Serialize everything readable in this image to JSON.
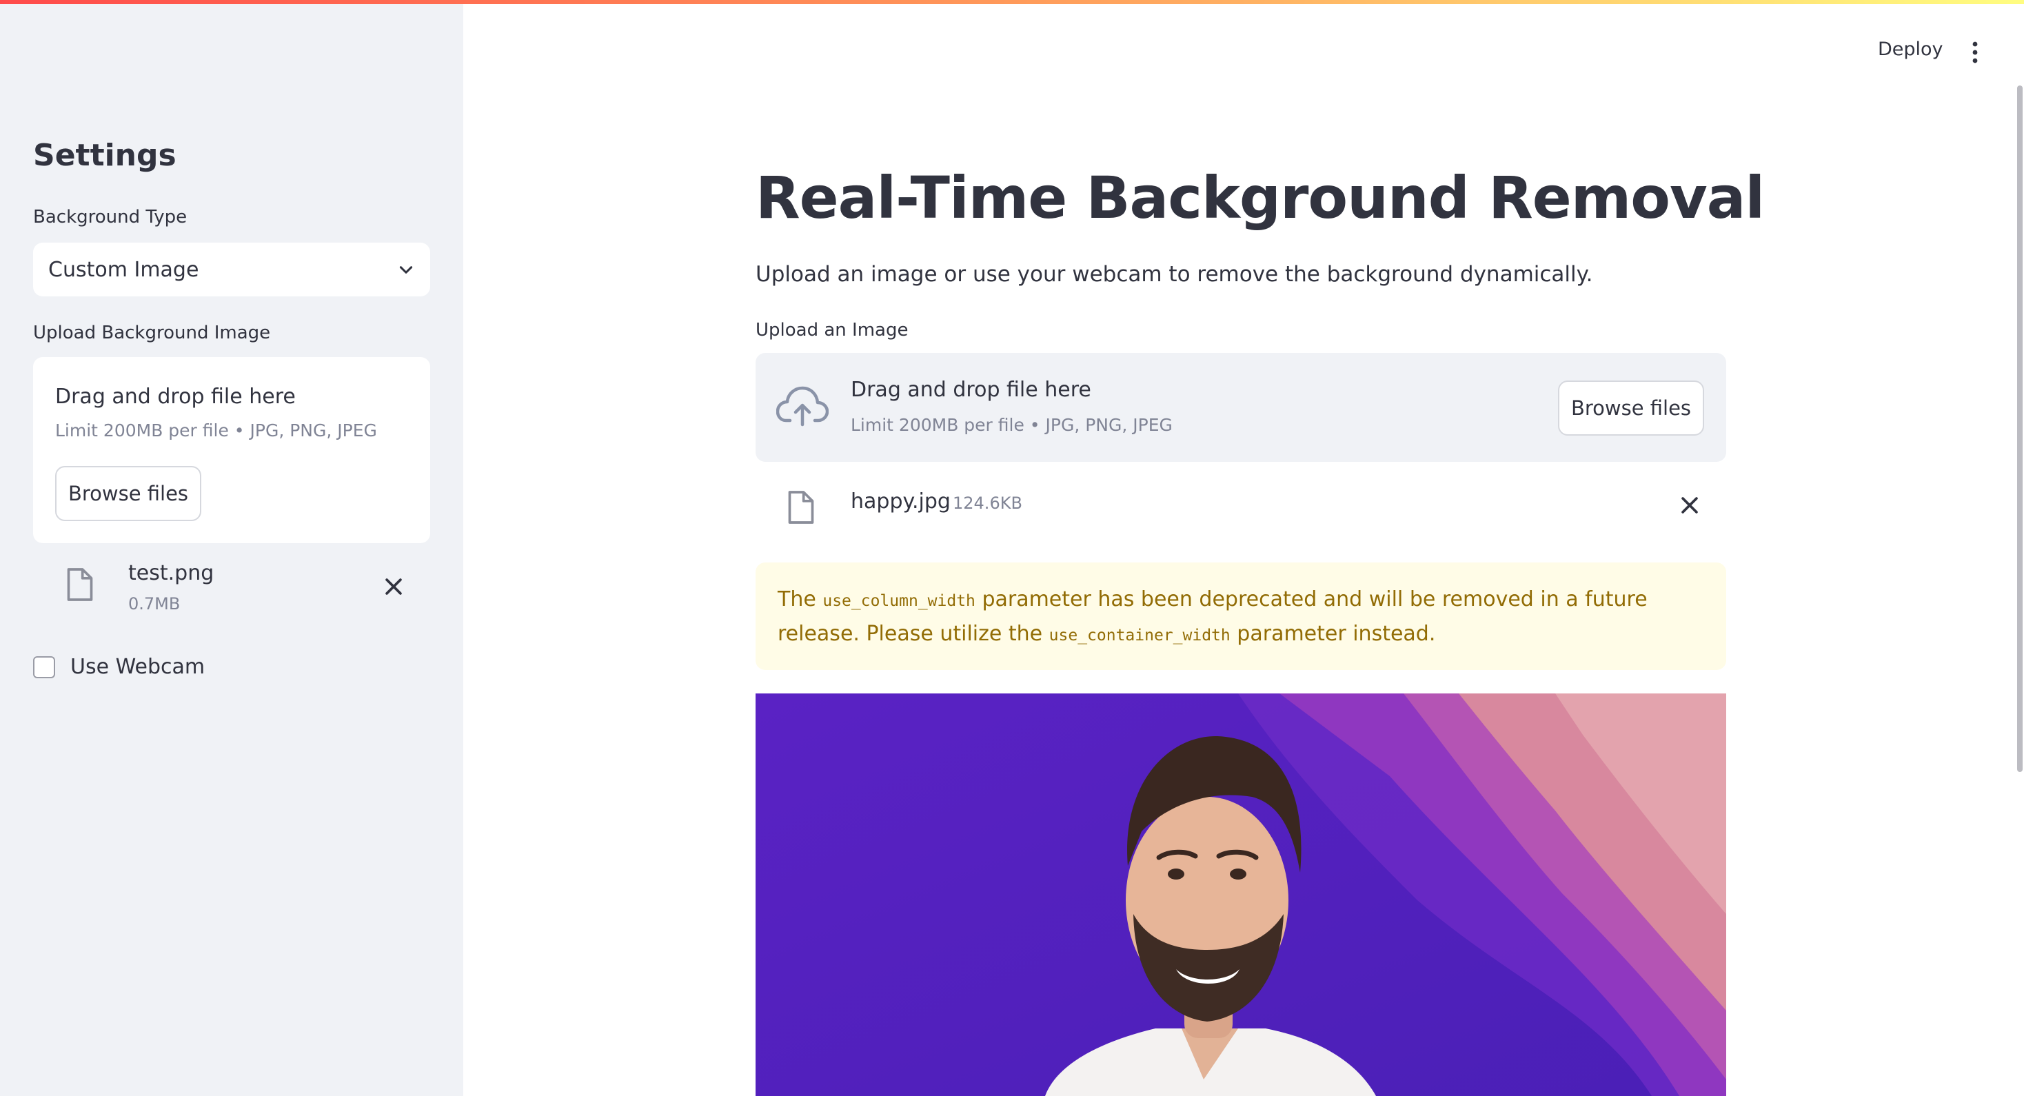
{
  "sidebar": {
    "title": "Settings",
    "background_type": {
      "label": "Background Type",
      "value": "Custom Image"
    },
    "upload": {
      "label": "Upload Background Image",
      "drop_title": "Drag and drop file here",
      "drop_limit": "Limit 200MB per file • JPG, PNG, JPEG",
      "browse_label": "Browse files",
      "file": {
        "name": "test.png",
        "size": "0.7MB"
      }
    },
    "webcam": {
      "label": "Use Webcam",
      "checked": false
    }
  },
  "header": {
    "deploy_label": "Deploy",
    "menu_icon": "kebab-menu-icon"
  },
  "main": {
    "title": "Real-Time Background Removal",
    "subtitle": "Upload an image or use your webcam to remove the background dynamically.",
    "upload": {
      "label": "Upload an Image",
      "drop_title": "Drag and drop file here",
      "drop_limit": "Limit 200MB per file • JPG, PNG, JPEG",
      "browse_label": "Browse files",
      "file": {
        "name": "happy.jpg",
        "size": "124.6KB"
      }
    },
    "alert": {
      "part1": "The ",
      "code1": "use_column_width",
      "part2": " parameter has been deprecated and will be removed in a future release. Please utilize the ",
      "code2": "use_container_width",
      "part3": " parameter instead."
    },
    "result_image": {
      "subject": "smiling man with beard in white t-shirt on purple and pink wave background"
    }
  },
  "colors": {
    "sidebar_bg": "#f0f2f6",
    "text": "#31333f",
    "muted": "#808495",
    "alert_bg": "#fffce7",
    "alert_text": "#926c05",
    "accent_gradient_start": "#ff4b4b",
    "accent_gradient_end": "#fffd80"
  }
}
